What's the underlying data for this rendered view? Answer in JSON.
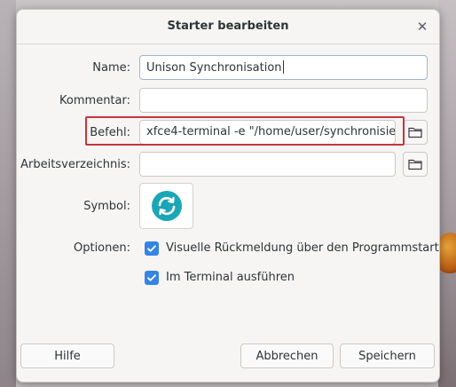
{
  "dialog": {
    "title": "Starter bearbeiten",
    "close_label": "✕"
  },
  "form": {
    "name_label": "Name:",
    "name_value": "Unison Synchronisation",
    "comment_label": "Kommentar:",
    "comment_value": "",
    "command_label": "Befehl:",
    "command_value": "xfce4-terminal -e \"/home/user/synchronisie",
    "workdir_label": "Arbeitsverzeichnis:",
    "workdir_value": "",
    "icon_label": "Symbol:",
    "icon_name": "sync-icon",
    "options_label": "Optionen:",
    "option_feedback": "Visuelle Rückmeldung über den Programmstart",
    "option_terminal": "Im Terminal ausführen",
    "option_feedback_checked": true,
    "option_terminal_checked": true
  },
  "buttons": {
    "help": "Hilfe",
    "cancel": "Abbrechen",
    "save": "Speichern"
  },
  "colors": {
    "accent": "#3584e4",
    "highlight_border": "#c9343b",
    "sync_icon": "#1aa6b7"
  }
}
